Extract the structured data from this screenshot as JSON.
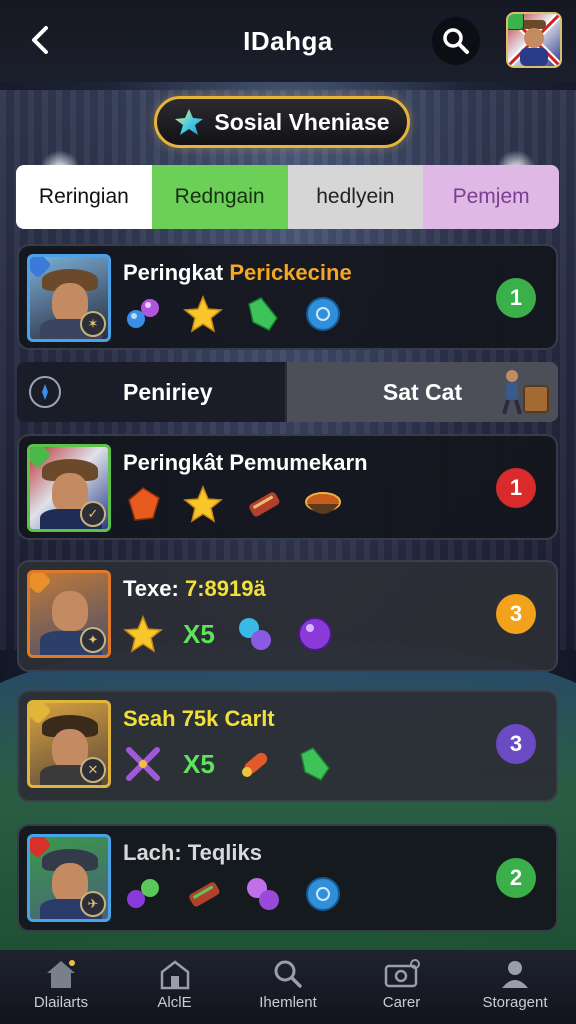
{
  "header": {
    "title": "IDahga"
  },
  "social_badge": {
    "label": "Sosial Vheniase"
  },
  "category_tabs": [
    {
      "label": "Reringian"
    },
    {
      "label": "Redngain"
    },
    {
      "label": "hedlyein"
    },
    {
      "label": "Pemjem"
    }
  ],
  "split_tabs": [
    {
      "label": "Peniriey"
    },
    {
      "label": "Sat Cat"
    }
  ],
  "cards": [
    {
      "title_prefix": "Peringkat ",
      "title_highlight": "Perickecine",
      "rank": "1",
      "rank_color": "#3bb04a",
      "portrait_border": "#4aa3e8",
      "items": [
        "gem-pair-icon",
        "star-icon",
        "green-crystal-icon",
        "blue-orb-icon"
      ]
    },
    {
      "title_prefix": "Peringkât Pemumekarn",
      "title_highlight": "",
      "rank": "1",
      "rank_color": "#d92b2b",
      "portrait_border": "#5cc24a",
      "items": [
        "orange-crystal-icon",
        "star-icon",
        "dynamite-icon",
        "food-bowl-icon"
      ]
    },
    {
      "title_prefix": "Texe: ",
      "title_highlight": "7:8919ä",
      "rank": "3",
      "rank_color": "#f2a21b",
      "portrait_border": "#e07a2a",
      "multiplier": "X5",
      "items": [
        "star-icon",
        "multiplier",
        "blue-orbs-icon",
        "purple-orb-icon"
      ]
    },
    {
      "title_prefix": "",
      "title_highlight": "Seah 75k Carlt",
      "rank": "3",
      "rank_color": "#6a4bc4",
      "portrait_border": "#e0b53a",
      "multiplier": "X5",
      "items": [
        "crossed-tools-icon",
        "multiplier",
        "rocket-icon",
        "green-crystal-icon"
      ]
    },
    {
      "title_prefix": "Lach: Teqliks",
      "title_highlight": "",
      "rank": "2",
      "rank_color": "#3bb04a",
      "portrait_border": "#4aa3e8",
      "items": [
        "gem-pair-icon",
        "dynamite-icon",
        "purple-orbs-icon",
        "blue-orb-icon"
      ]
    }
  ],
  "bottom_nav": [
    {
      "label": "Dlailarts",
      "icon": "home-icon"
    },
    {
      "label": "AlclE",
      "icon": "building-icon"
    },
    {
      "label": "Ihemlent",
      "icon": "search-icon"
    },
    {
      "label": "Carer",
      "icon": "camera-icon"
    },
    {
      "label": "Storagent",
      "icon": "person-icon"
    }
  ]
}
